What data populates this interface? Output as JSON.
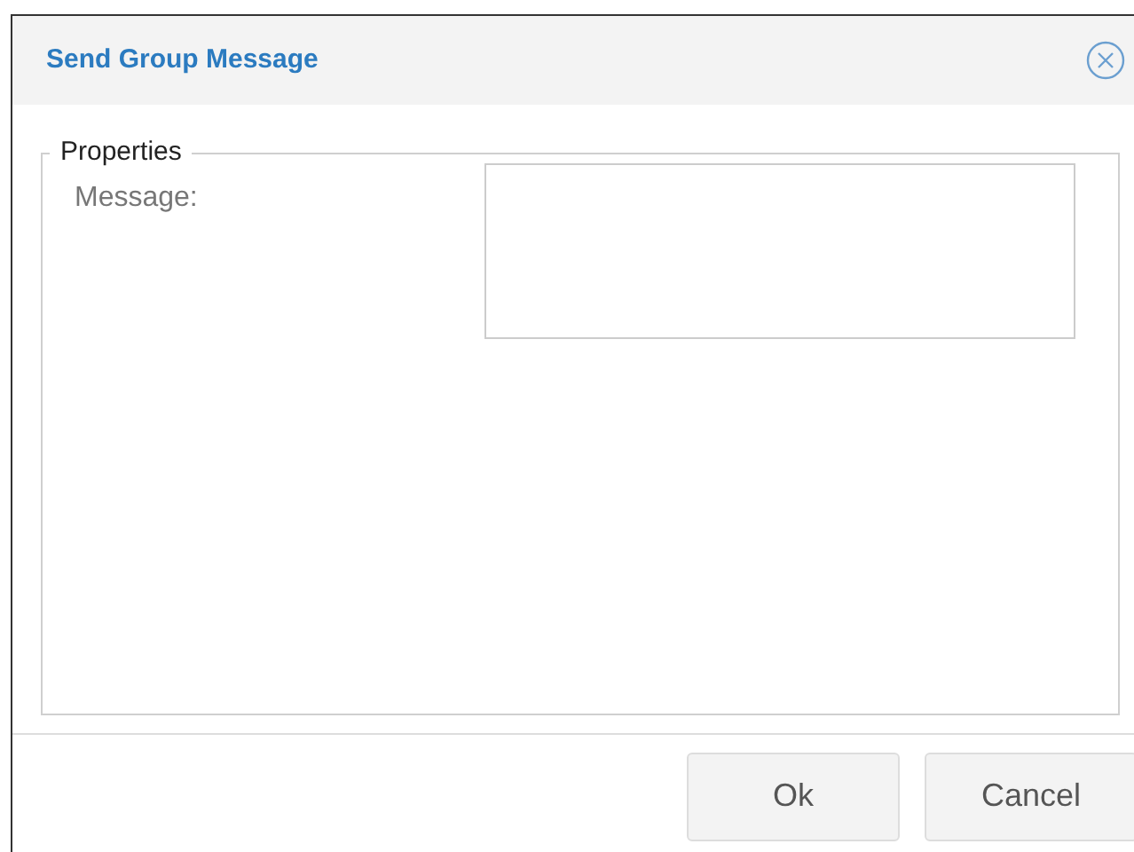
{
  "dialog": {
    "title": "Send Group Message"
  },
  "fieldset": {
    "legend": "Properties",
    "fields": [
      {
        "label": "Message:"
      }
    ]
  },
  "buttons": [
    "Ok",
    "Cancel"
  ]
}
